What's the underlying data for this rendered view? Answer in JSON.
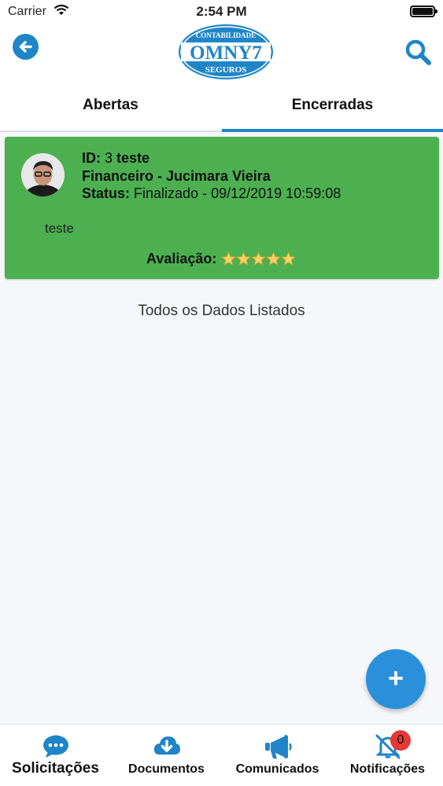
{
  "status_bar": {
    "carrier": "Carrier",
    "time": "2:54 PM"
  },
  "header": {
    "logo_top": "CONTABILIDADE",
    "logo_main": "OMNY7",
    "logo_bottom": "SEGUROS",
    "accent": "#1f85c8"
  },
  "tabs": [
    {
      "label": "Abertas",
      "active": false
    },
    {
      "label": "Encerradas",
      "active": true
    }
  ],
  "card": {
    "background": "#4cb051",
    "id_label": "ID:",
    "id_value": "3",
    "id_title": "teste",
    "department": "Financeiro - Jucimara Vieira",
    "status_label": "Status:",
    "status_value": "Finalizado - 09/12/2019 10:59:08",
    "description": "teste",
    "rating_label": "Avaliação:",
    "rating_stars": 5
  },
  "list_footer": "Todos os Dados Listados",
  "fab": {
    "label": "+"
  },
  "bottom_nav": [
    {
      "label": "Solicitações",
      "icon": "chat-bubble-icon",
      "active": true
    },
    {
      "label": "Documentos",
      "icon": "cloud-download-icon",
      "active": false
    },
    {
      "label": "Comunicados",
      "icon": "megaphone-icon",
      "active": false
    },
    {
      "label": "Notificações",
      "icon": "bell-off-icon",
      "active": false
    }
  ],
  "notification_badge": "0"
}
